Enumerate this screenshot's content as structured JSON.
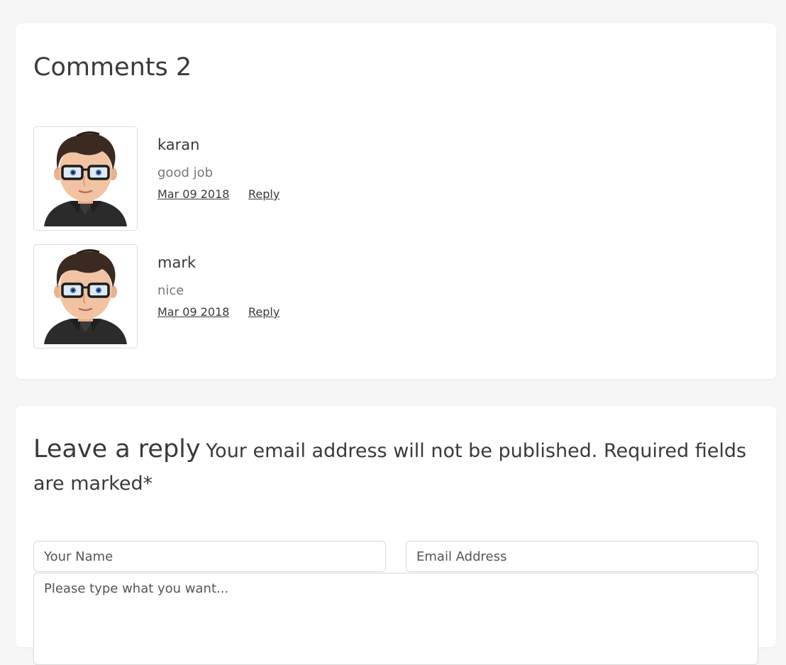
{
  "comments_section": {
    "title": "Comments 2",
    "comments": [
      {
        "author": "karan",
        "text": "good job",
        "date": "Mar 09 2018",
        "reply_label": "Reply"
      },
      {
        "author": "mark",
        "text": "nice",
        "date": "Mar 09 2018",
        "reply_label": "Reply"
      }
    ]
  },
  "reply_section": {
    "title": "Leave a reply",
    "note": "Your email address will not be published. Required fields are marked*",
    "name_placeholder": "Your Name",
    "email_placeholder": "Email Address",
    "message_placeholder": "Please type what you want..."
  },
  "icons": {
    "avatar": "avatar-icon"
  },
  "colors": {
    "background": "#f4f5f4",
    "card": "#ffffff",
    "text": "#3a3a3a",
    "muted": "#777777"
  }
}
